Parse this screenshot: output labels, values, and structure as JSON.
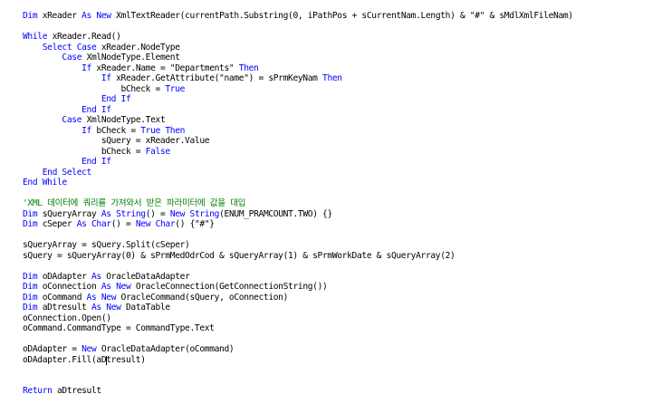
{
  "editor": {
    "language": "VB.NET",
    "colors": {
      "keyword": "#0000ff",
      "comment": "#008000",
      "text": "#000000",
      "background": "#ffffff"
    },
    "lines": [
      [
        {
          "t": "Dim",
          "c": "kw"
        },
        {
          "t": " xReader "
        },
        {
          "t": "As",
          "c": "kw"
        },
        {
          "t": " "
        },
        {
          "t": "New",
          "c": "kw"
        },
        {
          "t": " XmlTextReader(currentPath.Substring(0, iPathPos + sCurrentNam.Length) & \"#\" & sMdlXmlFileNam)"
        }
      ],
      [],
      [
        {
          "t": "While",
          "c": "kw"
        },
        {
          "t": " xReader.Read()"
        }
      ],
      [
        {
          "t": "    "
        },
        {
          "t": "Select Case",
          "c": "kw"
        },
        {
          "t": " xReader.NodeType"
        }
      ],
      [
        {
          "t": "        "
        },
        {
          "t": "Case",
          "c": "kw"
        },
        {
          "t": " XmlNodeType.Element"
        }
      ],
      [
        {
          "t": "            "
        },
        {
          "t": "If",
          "c": "kw"
        },
        {
          "t": " xReader.Name = \"Departments\" "
        },
        {
          "t": "Then",
          "c": "kw"
        }
      ],
      [
        {
          "t": "                "
        },
        {
          "t": "If",
          "c": "kw"
        },
        {
          "t": " xReader.GetAttribute(\"name\") = sPrmKeyNam "
        },
        {
          "t": "Then",
          "c": "kw"
        }
      ],
      [
        {
          "t": "                    bCheck = "
        },
        {
          "t": "True",
          "c": "kw"
        }
      ],
      [
        {
          "t": "                "
        },
        {
          "t": "End If",
          "c": "kw"
        }
      ],
      [
        {
          "t": "            "
        },
        {
          "t": "End If",
          "c": "kw"
        }
      ],
      [
        {
          "t": "        "
        },
        {
          "t": "Case",
          "c": "kw"
        },
        {
          "t": " XmlNodeType.Text"
        }
      ],
      [
        {
          "t": "            "
        },
        {
          "t": "If",
          "c": "kw"
        },
        {
          "t": " bCheck = "
        },
        {
          "t": "True Then",
          "c": "kw"
        }
      ],
      [
        {
          "t": "                sQuery = xReader.Value"
        }
      ],
      [
        {
          "t": "                bCheck = "
        },
        {
          "t": "False",
          "c": "kw"
        }
      ],
      [
        {
          "t": "            "
        },
        {
          "t": "End If",
          "c": "kw"
        }
      ],
      [
        {
          "t": "    "
        },
        {
          "t": "End Select",
          "c": "kw"
        }
      ],
      [
        {
          "t": "End While",
          "c": "kw"
        }
      ],
      [],
      [
        {
          "t": "'XML 데이터에 쿼리를 가져와서 받은 파라미터에 값을 대입",
          "c": "cm"
        }
      ],
      [
        {
          "t": "Dim",
          "c": "kw"
        },
        {
          "t": " sQueryArray "
        },
        {
          "t": "As",
          "c": "kw"
        },
        {
          "t": " "
        },
        {
          "t": "String",
          "c": "kw"
        },
        {
          "t": "() = "
        },
        {
          "t": "New",
          "c": "kw"
        },
        {
          "t": " "
        },
        {
          "t": "String",
          "c": "kw"
        },
        {
          "t": "(ENUM_PRAMCOUNT.TWO) {}"
        }
      ],
      [
        {
          "t": "Dim",
          "c": "kw"
        },
        {
          "t": " cSeper "
        },
        {
          "t": "As",
          "c": "kw"
        },
        {
          "t": " "
        },
        {
          "t": "Char",
          "c": "kw"
        },
        {
          "t": "() = "
        },
        {
          "t": "New",
          "c": "kw"
        },
        {
          "t": " "
        },
        {
          "t": "Char",
          "c": "kw"
        },
        {
          "t": "() {\"#\"}"
        }
      ],
      [],
      [
        {
          "t": "sQueryArray = sQuery.Split(cSeper)"
        }
      ],
      [
        {
          "t": "sQuery = sQueryArray(0) & sPrmMedOdrCod & sQueryArray(1) & sPrmWorkDate & sQueryArray(2)"
        }
      ],
      [],
      [
        {
          "t": "Dim",
          "c": "kw"
        },
        {
          "t": " oDAdapter "
        },
        {
          "t": "As",
          "c": "kw"
        },
        {
          "t": " OracleDataAdapter"
        }
      ],
      [
        {
          "t": "Dim",
          "c": "kw"
        },
        {
          "t": " oConnection "
        },
        {
          "t": "As",
          "c": "kw"
        },
        {
          "t": " "
        },
        {
          "t": "New",
          "c": "kw"
        },
        {
          "t": " OracleConnection(GetConnectionString())"
        }
      ],
      [
        {
          "t": "Dim",
          "c": "kw"
        },
        {
          "t": " oCommand "
        },
        {
          "t": "As",
          "c": "kw"
        },
        {
          "t": " "
        },
        {
          "t": "New",
          "c": "kw"
        },
        {
          "t": " OracleCommand(sQuery, oConnection)"
        }
      ],
      [
        {
          "t": "Dim",
          "c": "kw"
        },
        {
          "t": " aDtresult "
        },
        {
          "t": "As",
          "c": "kw"
        },
        {
          "t": " "
        },
        {
          "t": "New",
          "c": "kw"
        },
        {
          "t": " DataTable"
        }
      ],
      [
        {
          "t": "oConnection.Open()"
        }
      ],
      [
        {
          "t": "oCommand.CommandType = CommandType.Text"
        }
      ],
      [],
      [
        {
          "t": "oDAdapter = "
        },
        {
          "t": "New",
          "c": "kw"
        },
        {
          "t": " OracleDataAdapter(oCommand)"
        }
      ],
      [
        {
          "t": "oDAdapter.Fill(aDtresult)"
        }
      ],
      [],
      [],
      [
        {
          "t": "Return",
          "c": "kw"
        },
        {
          "t": " aDtresult"
        }
      ]
    ]
  }
}
